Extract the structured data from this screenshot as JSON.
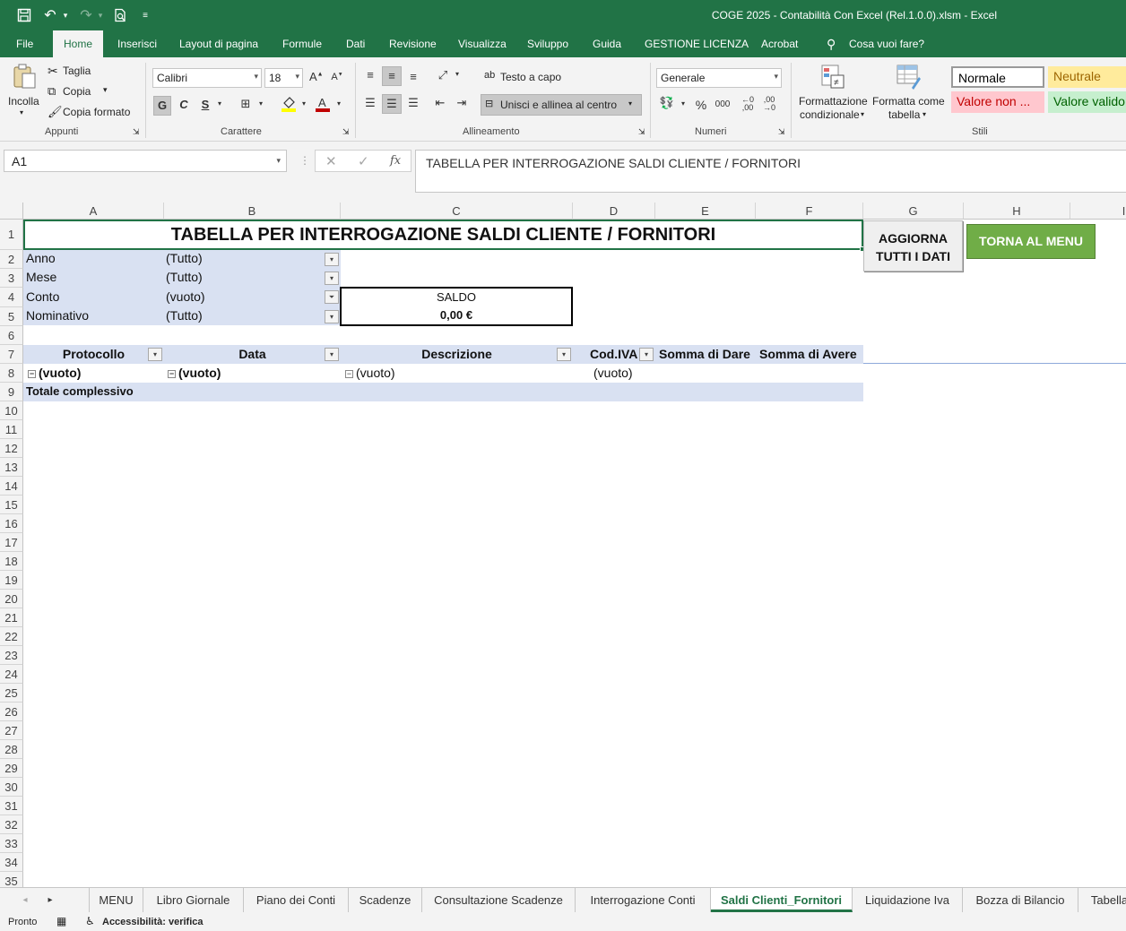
{
  "title_bar": {
    "window_title": "COGE 2025 - Contabilità Con Excel (Rel.1.0.0).xlsm  -  Excel",
    "icons": [
      "save-icon",
      "undo-icon",
      "redo-icon",
      "print-preview-icon",
      "customize-qat-icon"
    ]
  },
  "ribbon_tabs": [
    "File",
    "Home",
    "Inserisci",
    "Layout di pagina",
    "Formule",
    "Dati",
    "Revisione",
    "Visualizza",
    "Sviluppo",
    "Guida",
    "GESTIONE LICENZA",
    "Acrobat",
    "Cosa vuoi fare?"
  ],
  "ribbon": {
    "clipboard": {
      "paste": "Incolla",
      "cut": "Taglia",
      "copy": "Copia",
      "format_painter": "Copia formato",
      "group": "Appunti"
    },
    "font": {
      "name": "Calibri",
      "size": "18",
      "bold": "G",
      "italic": "C",
      "underline": "S",
      "group": "Carattere",
      "font_color": "#c00000",
      "fill_color": "#ffff00"
    },
    "alignment": {
      "wrap": "Testo a capo",
      "merge": "Unisci e allinea al centro",
      "group": "Allineamento"
    },
    "number": {
      "format": "Generale",
      "percent": "%",
      "thousands": "000",
      "group": "Numeri"
    },
    "styles": {
      "conditional_1": "Formattazione",
      "conditional_2": "condizionale",
      "as_table_1": "Formatta come",
      "as_table_2": "tabella",
      "normale": "Normale",
      "neutrale": "Neutrale",
      "valore_non": "Valore non ...",
      "valore_valido": "Valore valido",
      "group": "Stili"
    }
  },
  "formula_bar": {
    "name_box": "A1",
    "formula": "TABELLA PER INTERROGAZIONE SALDI CLIENTE / FORNITORI"
  },
  "columns": [
    "A",
    "B",
    "C",
    "D",
    "E",
    "F",
    "G",
    "H",
    "I"
  ],
  "rows": [
    "1",
    "2",
    "3",
    "4",
    "5",
    "6",
    "7",
    "8",
    "9",
    "10",
    "11",
    "12",
    "13",
    "14",
    "15",
    "16",
    "17",
    "18",
    "19",
    "20",
    "21",
    "22",
    "23",
    "24",
    "25",
    "26",
    "27",
    "28",
    "29",
    "30",
    "31",
    "32",
    "33",
    "34",
    "35"
  ],
  "sheet": {
    "title": "TABELLA PER INTERROGAZIONE SALDI CLIENTE / FORNITORI",
    "filters": [
      {
        "label": "Anno",
        "value": "(Tutto)"
      },
      {
        "label": "Mese",
        "value": "(Tutto)"
      },
      {
        "label": "Conto",
        "value": "(vuoto)"
      },
      {
        "label": "Nominativo",
        "value": "(Tutto)"
      }
    ],
    "saldo_label": "SALDO",
    "saldo_value": "0,00 €",
    "pivot_headers": [
      "Protocollo",
      "Data",
      "Descrizione",
      "Cod.IVA",
      "Somma di Dare",
      "Somma di Avere"
    ],
    "pivot_row": [
      "(vuoto)",
      "(vuoto)",
      "(vuoto)",
      "(vuoto)"
    ],
    "grand_total": "Totale complessivo",
    "button_refresh_1": "AGGIORNA",
    "button_refresh_2": "TUTTI I DATI",
    "button_menu": "TORNA AL MENU"
  },
  "sheet_tabs": [
    "MENU",
    "Libro Giornale",
    "Piano dei Conti",
    "Scadenze",
    "Consultazione Scadenze",
    "Interrogazione Conti",
    "Saldi Clienti_Fornitori",
    "Liquidazione Iva",
    "Bozza di Bilancio",
    "Tabella"
  ],
  "active_sheet": "Saldi Clienti_Fornitori",
  "status_bar": {
    "ready": "Pronto",
    "accessibility": "Accessibilità: verifica"
  },
  "colors": {
    "excel_green": "#217346",
    "pivot_band": "#d9e1f2",
    "menu_button": "#70ad47"
  }
}
